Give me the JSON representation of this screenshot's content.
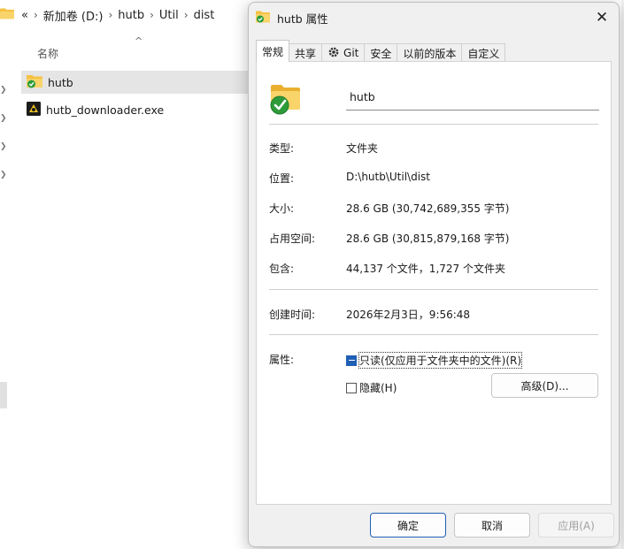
{
  "explorer": {
    "breadcrumb": {
      "overflow": "«",
      "items": [
        "新加卷 (D:)",
        "hutb",
        "Util",
        "dist"
      ]
    },
    "column_name": "名称",
    "files": [
      {
        "name": "hutb",
        "icon": "folder-sync-icon",
        "selected": true
      },
      {
        "name": "hutb_downloader.exe",
        "icon": "exe-app-icon",
        "selected": false
      }
    ]
  },
  "dialog": {
    "title": "hutb 属性",
    "close_glyph": "✕",
    "tabs": [
      {
        "label": "常规",
        "active": true
      },
      {
        "label": "共享",
        "active": false
      },
      {
        "label": "Git",
        "active": false,
        "icon": "git-gear-icon"
      },
      {
        "label": "安全",
        "active": false
      },
      {
        "label": "以前的版本",
        "active": false
      },
      {
        "label": "自定义",
        "active": false
      }
    ],
    "folder_name": "hutb",
    "properties": [
      {
        "label": "类型:",
        "value": "文件夹"
      },
      {
        "label": "位置:",
        "value": "D:\\hutb\\Util\\dist"
      },
      {
        "label": "大小:",
        "value": "28.6 GB (30,742,689,355 字节)"
      },
      {
        "label": "占用空间:",
        "value": "28.6 GB (30,815,879,168 字节)"
      },
      {
        "label": "包含:",
        "value": "44,137 个文件，1,727 个文件夹"
      }
    ],
    "created": {
      "label": "创建时间:",
      "value": "2026年2月3日，9:56:48"
    },
    "attributes": {
      "label": "属性:",
      "readonly_label": "只读(仅应用于文件夹中的文件)(R)",
      "readonly_state": "indeterminate",
      "hidden_label": "隐藏(H)",
      "hidden_checked": false,
      "advanced_label": "高级(D)..."
    },
    "buttons": {
      "ok": "确定",
      "cancel": "取消",
      "apply": "应用(A)"
    }
  },
  "colors": {
    "accent": "#1f5fb5",
    "folder": "#f5c242",
    "sync_badge": "#2e9b3a"
  }
}
